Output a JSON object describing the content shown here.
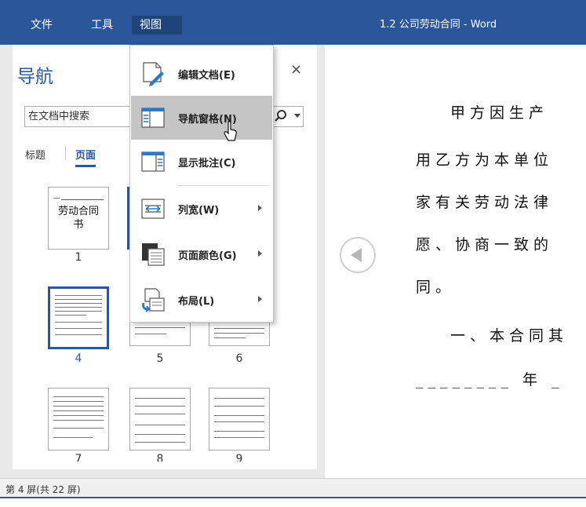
{
  "menu": {
    "file": "文件",
    "tools": "工具",
    "view": "视图"
  },
  "window_title": "1.2  公司劳动合同  -  Word",
  "nav": {
    "title": "导航",
    "close": "×",
    "search_placeholder": "在文档中搜索",
    "tabs": [
      "标题",
      "页面"
    ],
    "active_tab": "页面",
    "thumb1_title": "劳动合同书",
    "thumb_numbers": [
      "1",
      "4",
      "5",
      "6",
      "7",
      "8",
      "9"
    ],
    "selected_thumb": "4"
  },
  "view_menu": {
    "items": [
      {
        "label": "编辑文档(E)",
        "icon": "edit-document-icon",
        "submenu": false
      },
      {
        "label": "导航窗格(N)",
        "icon": "navigation-pane-icon",
        "submenu": false,
        "hover": true
      },
      {
        "label": "显示批注(C)",
        "icon": "show-comments-icon",
        "submenu": false
      },
      {
        "label": "列宽(W)",
        "icon": "column-width-icon",
        "submenu": true
      },
      {
        "label": "页面颜色(G)",
        "icon": "page-color-icon",
        "submenu": true
      },
      {
        "label": "布局(L)",
        "icon": "layout-icon",
        "submenu": true
      }
    ]
  },
  "document": {
    "lines": [
      "甲方因生产",
      "用乙方为本单位",
      "家有关劳动法律",
      "愿、协商一致的",
      "同。",
      "一、本合同其",
      "________ 年 _"
    ]
  },
  "status": {
    "text": "第 4 屏(共 22 屏)"
  },
  "colors": {
    "accent": "#2b579a",
    "menu_hover": "#c5c5c5"
  }
}
